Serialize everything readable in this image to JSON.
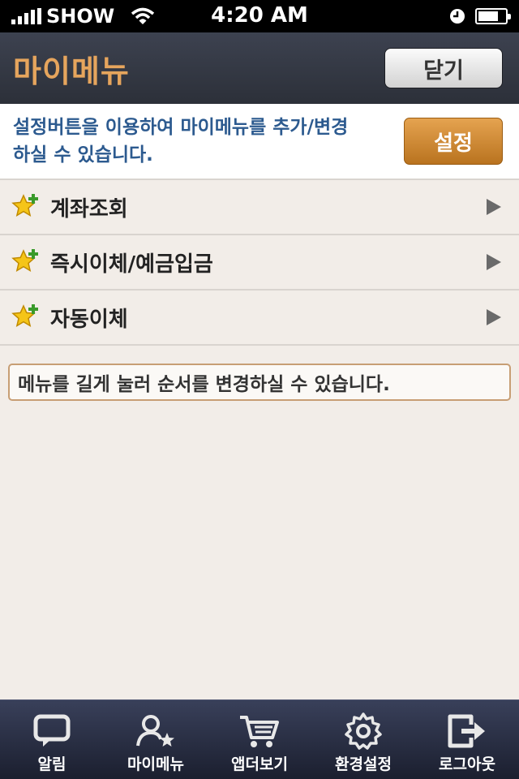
{
  "status_bar": {
    "carrier": "SHOW",
    "time": "4:20 AM",
    "battery_level": 0.75
  },
  "header": {
    "title": "마이메뉴",
    "close_label": "닫기"
  },
  "info": {
    "text": "설정버튼을 이용하여 마이메뉴를 추가/변경 하실 수 있습니다.",
    "settings_label": "설정"
  },
  "menu": {
    "items": [
      {
        "label": "계좌조회"
      },
      {
        "label": "즉시이체/예금입금"
      },
      {
        "label": "자동이체"
      }
    ]
  },
  "hint": {
    "text": "메뉴를 길게 눌러 순서를 변경하실 수 있습니다."
  },
  "tabs": [
    {
      "label": "알림",
      "icon": "chat-bubble-icon"
    },
    {
      "label": "마이메뉴",
      "icon": "person-star-icon"
    },
    {
      "label": "앱더보기",
      "icon": "cart-icon"
    },
    {
      "label": "환경설정",
      "icon": "gear-icon"
    },
    {
      "label": "로그아웃",
      "icon": "logout-icon"
    }
  ],
  "colors": {
    "accent": "#e6a55d",
    "info_text": "#2c5a8f",
    "background": "#f2ede8",
    "header_bg": "#2c3039"
  }
}
